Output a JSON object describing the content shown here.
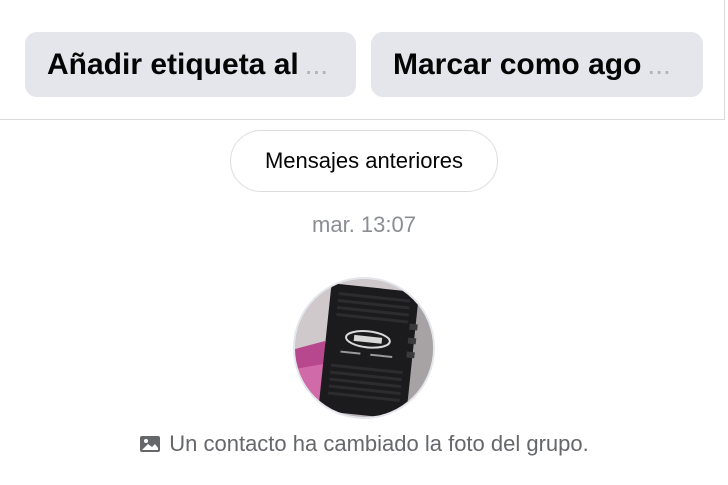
{
  "actions": {
    "add_tag_label": "Añadir etiqueta al",
    "mark_done_label": "Marcar como ago",
    "truncation": "..."
  },
  "thread": {
    "older_messages_label": "Mensajes anteriores",
    "timestamp": "mar. 13:07",
    "system_message": "Un contacto ha cambiado la foto del grupo.",
    "system_icon": "image-icon"
  },
  "colors": {
    "button_bg": "#e4e6eb",
    "muted_text": "#65676b",
    "timestamp_text": "#8a8d91"
  }
}
